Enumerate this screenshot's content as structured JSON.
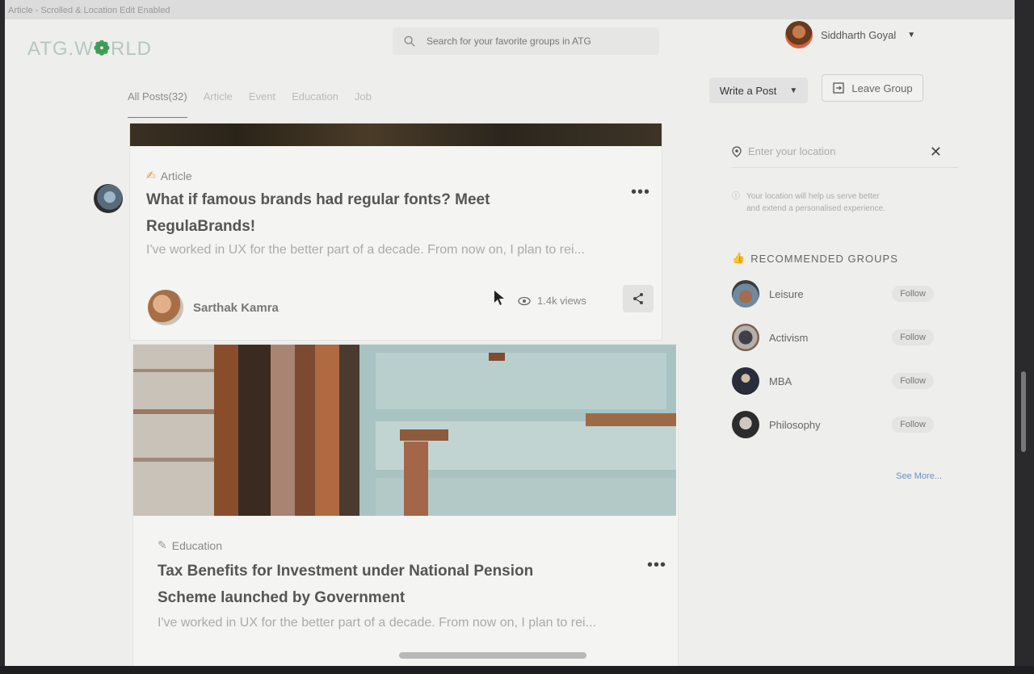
{
  "window": {
    "title": "Article - Scrolled & Location Edit Enabled"
  },
  "header": {
    "logo_prefix": "ATG.W",
    "logo_o": "❁",
    "logo_suffix": "RLD",
    "search_placeholder": "Search for your favorite groups in ATG",
    "user_name": "Siddharth Goyal"
  },
  "tabs": [
    "All Posts(32)",
    "Article",
    "Event",
    "Education",
    "Job"
  ],
  "actions": {
    "write_post": "Write a Post",
    "leave_group": "Leave Group"
  },
  "posts": [
    {
      "category": "Article",
      "title_line1": "What if famous brands had regular fonts? Meet",
      "title_line2": "RegulaBrands!",
      "excerpt": "I've worked in UX for the better part of a decade. From now on, I plan to rei...",
      "author": "Sarthak Kamra",
      "views": "1.4k views"
    },
    {
      "category": "Education",
      "title_line1": "Tax Benefits for Investment under National Pension",
      "title_line2": "Scheme launched by Government",
      "excerpt": "I've worked in UX for the better part of a decade. From now on, I plan to rei..."
    }
  ],
  "sidebar": {
    "location_placeholder": "Enter your location",
    "location_info_line1": "Your location will help us serve better",
    "location_info_line2": "and extend a personalised experience.",
    "recommended_title": "RECOMMENDED GROUPS",
    "groups": [
      {
        "name": "Leisure",
        "follow": "Follow"
      },
      {
        "name": "Activism",
        "follow": "Follow"
      },
      {
        "name": "MBA",
        "follow": "Follow"
      },
      {
        "name": "Philosophy",
        "follow": "Follow"
      }
    ],
    "see_more": "See More..."
  }
}
